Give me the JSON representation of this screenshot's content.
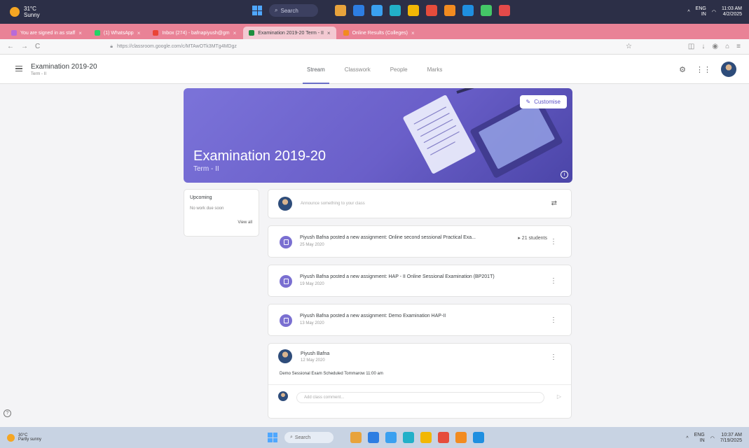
{
  "os_top": {
    "weather": {
      "temp": "31°C",
      "condition": "Sunny"
    },
    "search_label": "Search",
    "tray": {
      "lang": "ENG",
      "region": "IN",
      "time": "11:03 AM",
      "date": "4/2/2025"
    },
    "app_colors": [
      "#e8a33c",
      "#2d7de2",
      "#3aa0f0",
      "#22b0c8",
      "#f2b705",
      "#e64c3c",
      "#f28b20",
      "#1f8fe0",
      "#44c767",
      "#e34a4a"
    ]
  },
  "browser": {
    "tabs": [
      {
        "label": "You are signed in as staff",
        "active": false,
        "color": "#b86ad9"
      },
      {
        "label": "(1) WhatsApp",
        "active": false,
        "color": "#25d366"
      },
      {
        "label": "Inbox (274) - bafnapiyush@gm",
        "active": false,
        "color": "#ea4335"
      },
      {
        "label": "Examination 2019-20 Term - II",
        "active": true,
        "color": "#1e8e3e"
      },
      {
        "label": "Online Results (Colleges)",
        "active": false,
        "color": "#f28b20"
      }
    ],
    "url": "https://classroom.google.com/c/MTAwOTk3MTg4MDgz"
  },
  "classroom": {
    "class_title": "Examination 2019-20",
    "class_sub": "Term - II",
    "tabs": [
      "Stream",
      "Classwork",
      "People",
      "Marks"
    ],
    "active_tab": "Stream",
    "banner": {
      "title": "Examination 2019-20",
      "subtitle": "Term - II",
      "customise": "Customise"
    },
    "upcoming": {
      "heading": "Upcoming",
      "empty": "No work due soon",
      "view_all": "View all"
    },
    "announce_placeholder": "Announce something to your class",
    "assignments": [
      {
        "text": "Piyush Bafna posted a new assignment: Online second sessional Practical Exa...",
        "date": "25 May 2020",
        "students": "21 students"
      },
      {
        "text": "Piyush Bafna posted a new assignment: HAP - II Online Sessional Examination (BP201T)",
        "date": "19 May 2020",
        "students": ""
      },
      {
        "text": "Piyush Bafna posted a new assignment: Demo Examination HAP-II",
        "date": "13 May 2020",
        "students": ""
      }
    ],
    "post": {
      "author": "Piyush Bafna",
      "date": "12 May 2020",
      "body": "Demo Sessional Exam Scheduled Tommarow 11:00 am",
      "comment_placeholder": "Add class comment..."
    }
  },
  "os_bottom": {
    "weather": {
      "temp": "30°C",
      "condition": "Partly sunny"
    },
    "search_label": "Search",
    "tray": {
      "lang": "ENG",
      "region": "IN",
      "time": "10:37 AM",
      "date": "7/19/2025"
    }
  }
}
